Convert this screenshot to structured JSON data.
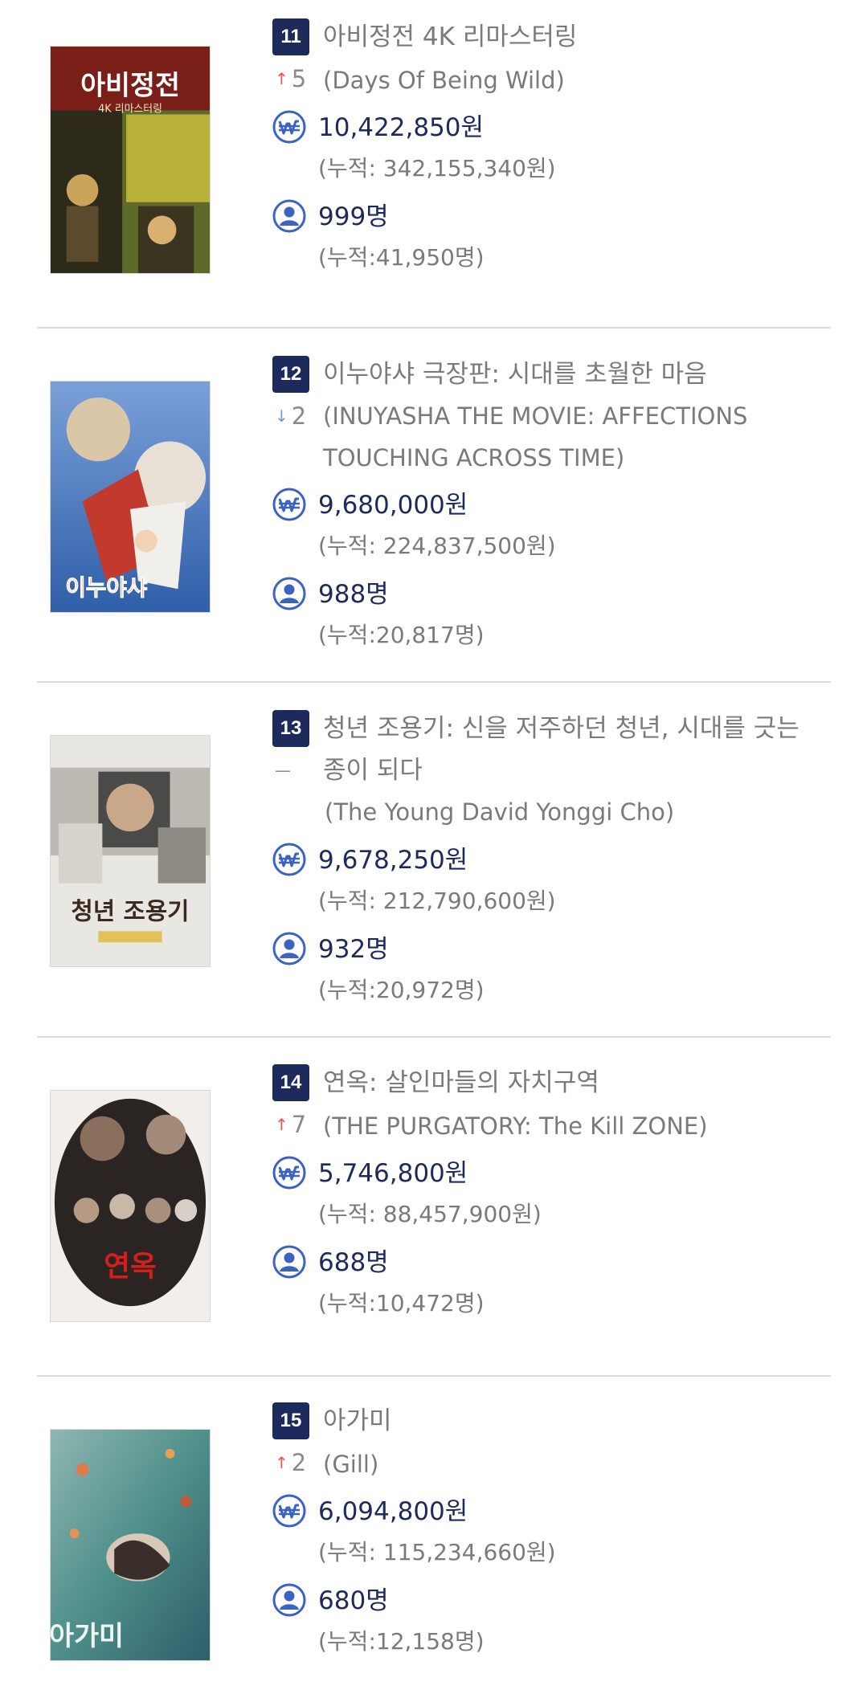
{
  "colors": {
    "badge_bg": "#1c2a5c",
    "value_text": "#1c2a5c",
    "muted_text": "#7a7a7a",
    "icon_blue": "#3b63c4",
    "rank_up": "#e8564a",
    "rank_down": "#6f9ad6",
    "divider": "#dcdcdc"
  },
  "icons": {
    "sales": "won-circle-icon",
    "audience": "person-circle-icon",
    "up": "arrow-up-icon",
    "down": "arrow-down-icon",
    "same": "dash-icon"
  },
  "movies": [
    {
      "rank": "11",
      "title": "아비정전 4K 리마스터링",
      "change_dir": "up",
      "change_arrow": "↑",
      "change_value": "5",
      "original_title": "(Days Of Being Wild)",
      "sales": "10,422,850원",
      "sales_cumulative": "(누적: 342,155,340원)",
      "audience": "999명",
      "audience_cumulative": "(누적:41,950명)",
      "poster_text": "아비정전",
      "poster_subtext": "4K 리마스터링"
    },
    {
      "rank": "12",
      "title": "이누야샤 극장판: 시대를 초월한 마음",
      "change_dir": "down",
      "change_arrow": "↓",
      "change_value": "2",
      "original_title": "(INUYASHA THE MOVIE: AFFECTIONS TOUCHING ACROSS TIME)",
      "sales": "9,680,000원",
      "sales_cumulative": "(누적: 224,837,500원)",
      "audience": "988명",
      "audience_cumulative": "(누적:20,817명)",
      "poster_text": "이누야샤",
      "poster_subtext": ""
    },
    {
      "rank": "13",
      "title": "청년 조용기: 신을 저주하던 청년, 시대를 긋는 종이 되다",
      "change_dir": "same",
      "change_arrow": "—",
      "change_value": "",
      "original_title": "(The Young David Yonggi Cho)",
      "sales": "9,678,250원",
      "sales_cumulative": "(누적: 212,790,600원)",
      "audience": "932명",
      "audience_cumulative": "(누적:20,972명)",
      "poster_text": "청년 조용기",
      "poster_subtext": ""
    },
    {
      "rank": "14",
      "title": "연옥: 살인마들의 자치구역",
      "change_dir": "up",
      "change_arrow": "↑",
      "change_value": "7",
      "original_title": "(THE PURGATORY: The Kill ZONE)",
      "sales": "5,746,800원",
      "sales_cumulative": "(누적: 88,457,900원)",
      "audience": "688명",
      "audience_cumulative": "(누적:10,472명)",
      "poster_text": "연옥",
      "poster_subtext": ""
    },
    {
      "rank": "15",
      "title": "아가미",
      "change_dir": "up",
      "change_arrow": "↑",
      "change_value": "2",
      "original_title": "(Gill)",
      "sales": "6,094,800원",
      "sales_cumulative": "(누적: 115,234,660원)",
      "audience": "680명",
      "audience_cumulative": "(누적:12,158명)",
      "poster_text": "아가미",
      "poster_subtext": ""
    }
  ]
}
